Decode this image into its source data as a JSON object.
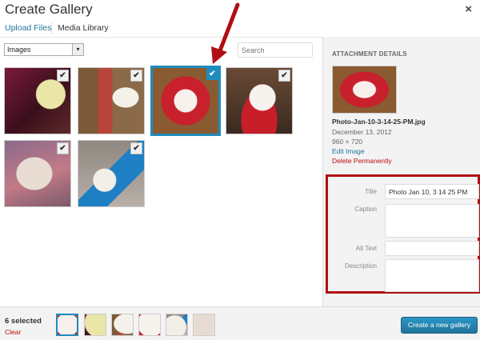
{
  "header": {
    "title": "Create Gallery",
    "close_symbol": "×"
  },
  "tabs": [
    {
      "label": "Upload Files"
    },
    {
      "label": "Media Library"
    }
  ],
  "toolbar": {
    "filter_value": "Images",
    "filter_arrow": "▾",
    "search_placeholder": "Search"
  },
  "check_symbol": "✔",
  "grid": {
    "items": [
      {
        "photo": "dog-on-pink-blanket"
      },
      {
        "photo": "dog-with-meaty-bone-box"
      },
      {
        "photo": "dog-in-red-bed",
        "selected": true
      },
      {
        "photo": "dog-in-red-sweater"
      },
      {
        "photo": "dog-on-pillow"
      },
      {
        "photo": "dog-with-blue-box"
      }
    ]
  },
  "details": {
    "heading": "ATTACHMENT DETAILS",
    "filename": "Photo-Jan-10-3-14-25-PM.jpg",
    "date": "December 13, 2012",
    "dimensions": "960 × 720",
    "edit_link": "Edit Image",
    "delete_link": "Delete Permanently",
    "fields": {
      "title_label": "Title",
      "title_value": "Photo Jan 10, 3 14 25 PM",
      "caption_label": "Caption",
      "caption_value": "",
      "alt_label": "Alt Text",
      "alt_value": "",
      "description_label": "Description",
      "description_value": ""
    }
  },
  "selection": {
    "count_label": "6 selected",
    "clear_label": "Clear"
  },
  "primary_button": "Create a new gallery",
  "colors": {
    "accent": "#1e8cbe",
    "link": "#21759b",
    "danger": "#bc0b0b",
    "highlight_box": "#b00e13"
  }
}
